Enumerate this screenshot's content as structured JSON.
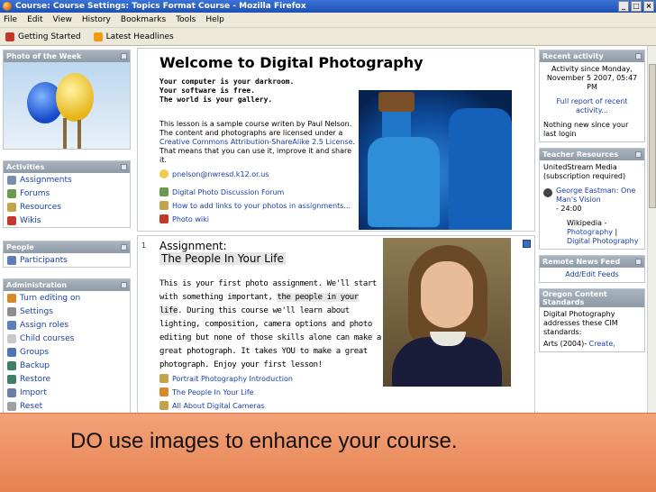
{
  "window": {
    "title": "Course: Course Settings: Topics Format Course - Mozilla Firefox",
    "min": "_",
    "max": "□",
    "close": "×"
  },
  "menu": [
    "File",
    "Edit",
    "View",
    "History",
    "Bookmarks",
    "Tools",
    "Help"
  ],
  "bookmarks": [
    "Getting Started",
    "Latest Headlines"
  ],
  "left": {
    "photo_title": "Photo of the Week",
    "activities_title": "Activities",
    "activities": [
      "Assignments",
      "Forums",
      "Resources",
      "Wikis"
    ],
    "people_title": "People",
    "people": [
      "Participants"
    ],
    "admin_title": "Administration",
    "admin": [
      "Turn editing on",
      "Settings",
      "Assign roles",
      "Child courses",
      "Groups",
      "Backup",
      "Restore",
      "Import",
      "Reset"
    ]
  },
  "main": {
    "welcome": "Welcome to Digital Photography",
    "tagline": [
      "Your computer is your darkroom.",
      "Your software is free.",
      "The world is your gallery."
    ],
    "intro_before": "This lesson is a sample course writen by Paul Nelson. The content and photographs are licensed under a ",
    "intro_link": "Creative Commons Attribution-ShareAlike 2.5 License",
    "intro_after": ". That means that you can use it, improve it and share it.",
    "email": "pnelson@nwresd.k12.or.us",
    "links": [
      "Digital Photo Discussion Forum",
      "How to add links to your photos in assignments...",
      "Photo wiki"
    ],
    "section_num": "1",
    "assign_title": "Assignment",
    "assign_colon": ":",
    "assign_sub": "The People In Your Life",
    "assign_text_1": "This is your first photo assignment. We'll start with something important, ",
    "assign_highlight": "the people in your life",
    "assign_text_2": ". During this course we'll learn about lighting, composition, camera options and photo editing but none of those skills alone can make a great photograph. It takes YOU to make a great photograph. Enjoy your first lesson!",
    "resources": [
      "Portrait Photography Introduction",
      "The People In Your Life",
      "All About Digital Cameras"
    ]
  },
  "right": {
    "recent_title": "Recent activity",
    "recent_since": "Activity since Monday, November 5 2007, 05:47 PM",
    "recent_link": "Full report of recent activity...",
    "recent_none": "Nothing new since your last login",
    "teacher_title": "Teacher Resources",
    "teacher_1": "UnitedStream Media (subscription required)",
    "teacher_video": "George Eastman: One Man's Vision",
    "teacher_time": "- 24:00",
    "wiki": "Wikipedia -",
    "wiki_link1": "Photography",
    "wiki_sep": "|",
    "wiki_link2": "Digital Photography",
    "news_title": "Remote News Feed",
    "news_link": "Add/Edit Feeds",
    "oregon_title": "Oregon Content Standards",
    "oregon_text": "Digital Photography addresses these CIM standards:",
    "oregon_arts": "Arts (2004)-",
    "oregon_create": "Create,"
  },
  "caption": "DO use images to enhance your course.",
  "colors": {
    "titlebar": "#1f4fb4",
    "link": "#1a3fa6",
    "overlay": "#e6824f",
    "block_header": "#8e9aa6"
  }
}
